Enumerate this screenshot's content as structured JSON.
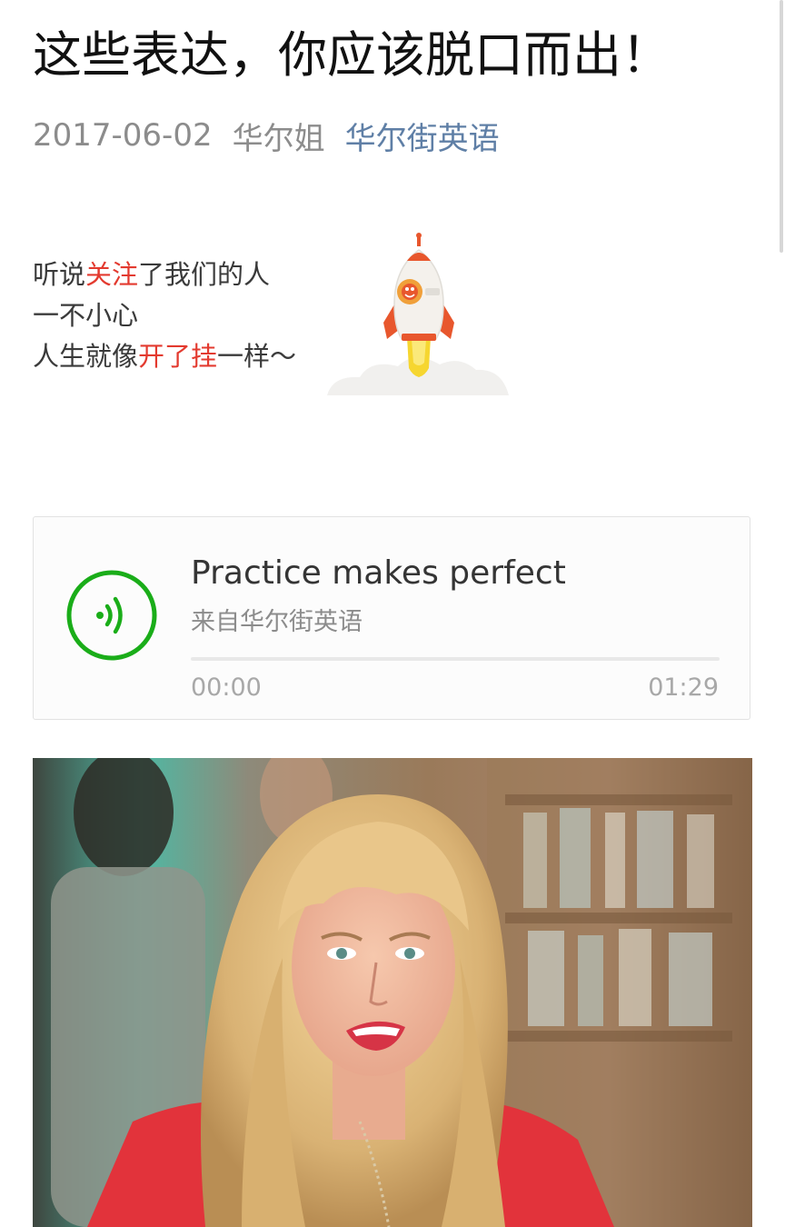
{
  "article": {
    "title": "这些表达，你应该脱口而出！",
    "date": "2017-06-02",
    "author": "华尔姐",
    "account": "华尔街英语"
  },
  "promo": {
    "line1": {
      "a": "听说",
      "b": "关注",
      "c": "了我们的人"
    },
    "line2": "一不小心",
    "line3": {
      "a": "人生就像",
      "b": "开了挂",
      "c": "一样～"
    }
  },
  "audio": {
    "title": "Practice makes perfect",
    "source": "来自华尔街英语",
    "current_time": "00:00",
    "total_time": "01:29",
    "progress": 0
  },
  "colors": {
    "link_blue": "#5f7fa6",
    "wechat_green": "#1aad19",
    "promo_red": "#e33a2f"
  },
  "icons": {
    "play": "audio-wave-icon",
    "promo": "rocket-icon"
  }
}
